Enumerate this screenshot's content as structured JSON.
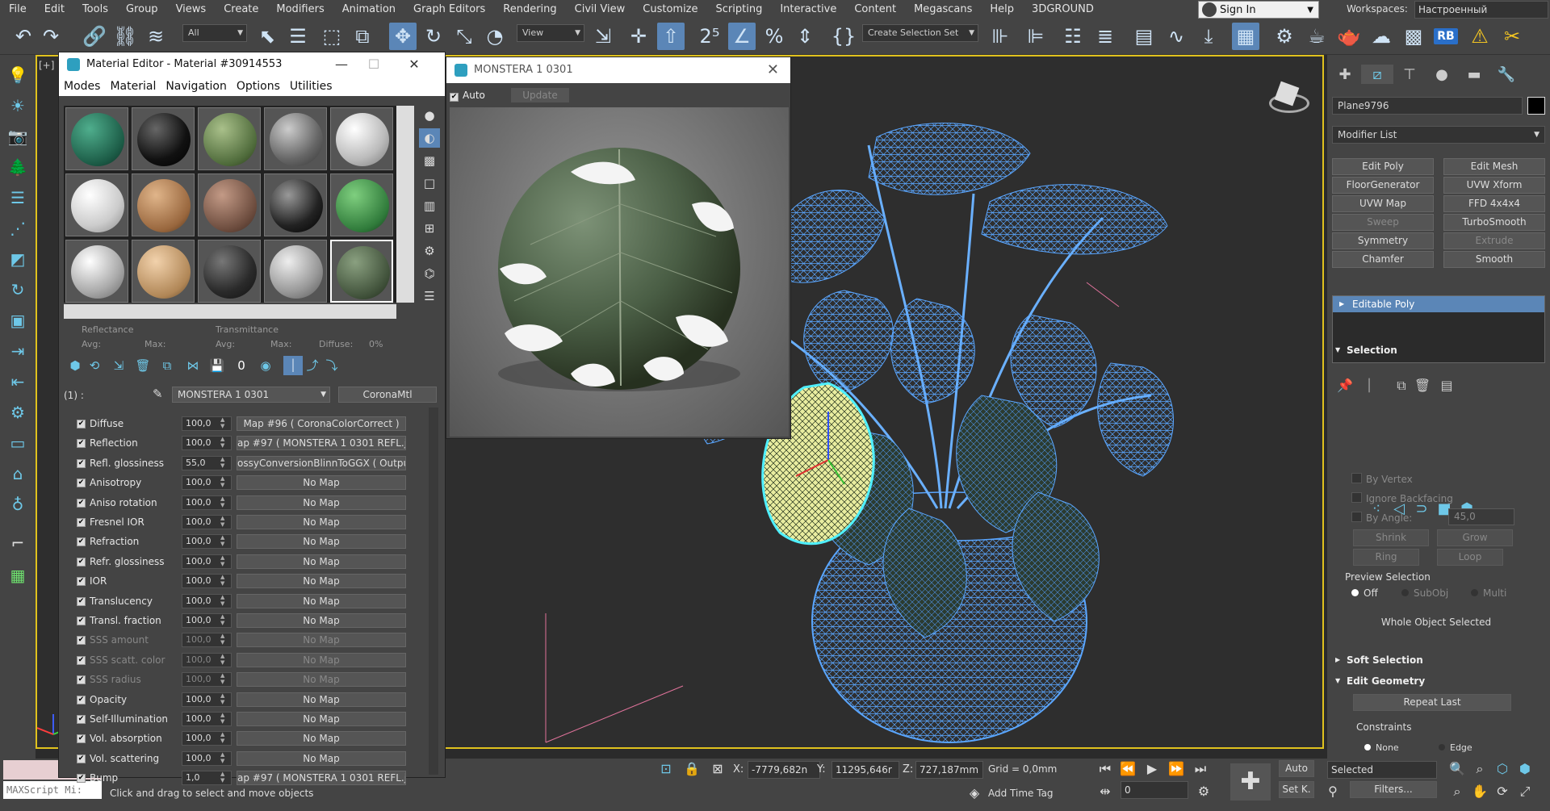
{
  "menu": [
    "File",
    "Edit",
    "Tools",
    "Group",
    "Views",
    "Create",
    "Modifiers",
    "Animation",
    "Graph Editors",
    "Rendering",
    "Civil View",
    "Customize",
    "Scripting",
    "Interactive",
    "Content",
    "Megascans",
    "Help",
    "3DGROUND"
  ],
  "signin": "Sign In",
  "workspaces": {
    "label": "Workspaces:",
    "value": "Настроенный"
  },
  "toolbar": {
    "filter": "All",
    "refcoord": "View",
    "selection_set": "Create Selection Set"
  },
  "viewport_label": "[+]",
  "command_panel": {
    "object_name": "Plane9796",
    "modifier_list": "Modifier List",
    "modifier_buttons": [
      {
        "label": "Edit Poly",
        "enabled": true
      },
      {
        "label": "Edit Mesh",
        "enabled": true
      },
      {
        "label": "FloorGenerator",
        "enabled": true
      },
      {
        "label": "UVW Xform",
        "enabled": true
      },
      {
        "label": "UVW Map",
        "enabled": true
      },
      {
        "label": "FFD 4x4x4",
        "enabled": true
      },
      {
        "label": "Sweep",
        "enabled": false
      },
      {
        "label": "TurboSmooth",
        "enabled": true
      },
      {
        "label": "Symmetry",
        "enabled": true
      },
      {
        "label": "Extrude",
        "enabled": false
      },
      {
        "label": "Chamfer",
        "enabled": true
      },
      {
        "label": "Smooth",
        "enabled": true
      }
    ],
    "stack_item": "Editable Poly",
    "selection": {
      "header": "Selection",
      "by_vertex": "By Vertex",
      "ignore_backfacing": "Ignore Backfacing",
      "by_angle": "By Angle:",
      "angle_value": "45,0",
      "shrink": "Shrink",
      "grow": "Grow",
      "ring": "Ring",
      "loop": "Loop",
      "preview_selection": "Preview Selection",
      "off": "Off",
      "subobj": "SubObj",
      "multi": "Multi",
      "status": "Whole Object Selected"
    },
    "soft_selection": "Soft Selection",
    "edit_geometry": "Edit Geometry",
    "repeat_last": "Repeat Last",
    "constraints": "Constraints",
    "none": "None",
    "edge": "Edge"
  },
  "material_editor": {
    "title": "Material Editor - Material #30914553",
    "menu": [
      "Modes",
      "Material",
      "Navigation",
      "Options",
      "Utilities"
    ],
    "reflectance": "Reflectance",
    "transmittance": "Transmittance",
    "avg": "Avg:",
    "max": "Max:",
    "diffuse_label": "Diffuse:",
    "diffuse_pct": "0%",
    "slot_index": "(1) :",
    "material_name": "MONSTERA 1 0301",
    "material_type": "CoronaMtl",
    "params": [
      {
        "name": "Diffuse",
        "value": "100,0",
        "map": "Map #96  ( CoronaColorCorrect )",
        "enabled": true
      },
      {
        "name": "Reflection",
        "value": "100,0",
        "map": "ap #97 ( MONSTERA 1 0301 REFL.jpe",
        "enabled": true
      },
      {
        "name": "Refl. glossiness",
        "value": "55,0",
        "map": "ossyConversionBlinnToGGX  ( Output",
        "enabled": true
      },
      {
        "name": "Anisotropy",
        "value": "100,0",
        "map": "No Map",
        "enabled": true
      },
      {
        "name": "Aniso rotation",
        "value": "100,0",
        "map": "No Map",
        "enabled": true
      },
      {
        "name": "Fresnel IOR",
        "value": "100,0",
        "map": "No Map",
        "enabled": true
      },
      {
        "name": "Refraction",
        "value": "100,0",
        "map": "No Map",
        "enabled": true
      },
      {
        "name": "Refr. glossiness",
        "value": "100,0",
        "map": "No Map",
        "enabled": true
      },
      {
        "name": "IOR",
        "value": "100,0",
        "map": "No Map",
        "enabled": true
      },
      {
        "name": "Translucency",
        "value": "100,0",
        "map": "No Map",
        "enabled": true
      },
      {
        "name": "Transl. fraction",
        "value": "100,0",
        "map": "No Map",
        "enabled": true
      },
      {
        "name": "SSS amount",
        "value": "100,0",
        "map": "No Map",
        "enabled": false
      },
      {
        "name": "SSS scatt. color",
        "value": "100,0",
        "map": "No Map",
        "enabled": false
      },
      {
        "name": "SSS radius",
        "value": "100,0",
        "map": "No Map",
        "enabled": false
      },
      {
        "name": "Opacity",
        "value": "100,0",
        "map": "No Map",
        "enabled": true
      },
      {
        "name": "Self-Illumination",
        "value": "100,0",
        "map": "No Map",
        "enabled": true
      },
      {
        "name": "Vol. absorption",
        "value": "100,0",
        "map": "No Map",
        "enabled": true
      },
      {
        "name": "Vol. scattering",
        "value": "100,0",
        "map": "No Map",
        "enabled": true
      },
      {
        "name": "Bump",
        "value": "1,0",
        "map": "ap #97 ( MONSTERA 1 0301 REFL.jpe",
        "enabled": true
      }
    ]
  },
  "render_window": {
    "title": "MONSTERA 1 0301",
    "auto": "Auto",
    "update": "Update"
  },
  "status": {
    "maxscript": "MAXScript Mi:",
    "message": "Click and drag to select and move objects",
    "x_label": "X:",
    "x": "-7779,682n",
    "y_label": "Y:",
    "y": "11295,646r",
    "z_label": "Z:",
    "z": "727,187mm",
    "grid": "Grid = 0,0mm",
    "add_time_tag": "Add Time Tag",
    "frame": "0",
    "auto": "Auto",
    "selected": "Selected",
    "setk": "Set K.",
    "filters": "Filters..."
  }
}
